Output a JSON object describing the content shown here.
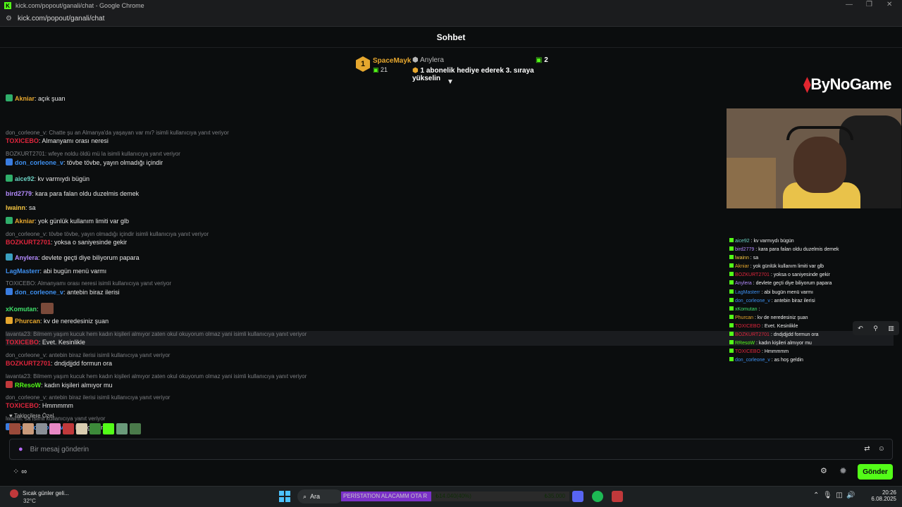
{
  "window": {
    "title": "kick.com/popout/ganali/chat - Google Chrome",
    "url": "kick.com/popout/ganali/chat",
    "controls": [
      "—",
      "❐",
      "✕"
    ]
  },
  "header": {
    "title": "Sohbet"
  },
  "pinned": {
    "rank": "1",
    "top_user": "SpaceMayk",
    "gift_count": "21",
    "second_user": "Anylera",
    "second_count": "2",
    "promo": "1 abonelik hediye ederek 3. sıraya yükselin"
  },
  "messages": [
    {
      "reply": "",
      "user": "Akniar",
      "color": "#e6a72e",
      "text": ": açık şuan",
      "badge": "#2fae6a"
    },
    {
      "reply": "don_corleone_v: Chatte şu an Almanya'da yaşayan var mı? isimli kullanıcıya yanıt veriyor",
      "user": "TOXICEBO",
      "color": "#e0263d",
      "text": ": Almanyamı orası neresi",
      "badge": ""
    },
    {
      "reply": "BOZKURT2701: wfeye noldu öldü mü la isimli kullanıcıya yanıt veriyor",
      "user": "don_corleone_v",
      "color": "#3e90f0",
      "text": ": tövbe tövbe, yayın olmadığı içindir",
      "badge": "#3a7de0"
    },
    {
      "reply": "",
      "user": "aice92",
      "color": "#6cd4c5",
      "text": ": kv varmıydı bügün",
      "badge": "#2fae6a"
    },
    {
      "reply": "",
      "user": "bird2779",
      "color": "#b58cff",
      "text": ": kara para falan oldu duzelmis demek",
      "badge": ""
    },
    {
      "reply": "",
      "user": "lwainn",
      "color": "#f5c542",
      "text": ": sa",
      "badge": ""
    },
    {
      "reply": "",
      "user": "Akniar",
      "color": "#e6a72e",
      "text": ": yok günlük kullanım limiti var glb",
      "badge": "#2fae6a"
    },
    {
      "reply": "don_corleone_v: tövbe tövbe, yayın olmadığı içindir isimli kullanıcıya yanıt veriyor",
      "user": "BOZKURT2701",
      "color": "#e0263d",
      "text": ": yoksa o saniyesinde gekir",
      "badge": ""
    },
    {
      "reply": "",
      "user": "Anylera",
      "color": "#b58cff",
      "text": ": devlete geçti diye biliyorum papara",
      "badge": "#3aa0c0"
    },
    {
      "reply": "",
      "user": "LagMasterr",
      "color": "#3e90f0",
      "text": ": abi bugün menü varmı",
      "badge": ""
    },
    {
      "reply": "TOXICEBO: Almanyamı orası neresi isimli kullanıcıya yanıt veriyor",
      "user": "don_corleone_v",
      "color": "#3e90f0",
      "text": ": antebin biraz ilerisi",
      "badge": "#3a7de0"
    },
    {
      "reply": "",
      "user": "xKomutan",
      "color": "#3fe06a",
      "text": ":",
      "badge": "",
      "emote": true
    },
    {
      "reply": "",
      "user": "Phurcan",
      "color": "#e6a72e",
      "text": ": kv de neredesiniz şuan",
      "badge": "#e6a72e"
    },
    {
      "reply": "lavanta23: Bilmem yaşım kucuk hem kadın kişileri almıyor zaten okul okuyorum olmaz yani isimli kullanıcıya yanıt veriyor",
      "user": "TOXICEBO",
      "color": "#e0263d",
      "text": ": Evet. Kesinlikle",
      "badge": "",
      "highlight": true
    },
    {
      "reply": "don_corleone_v: antebin biraz ilerisi isimli kullanıcıya yanıt veriyor",
      "user": "BOZKURT2701",
      "color": "#e0263d",
      "text": ": dndjdjjdd formun ora",
      "badge": ""
    },
    {
      "reply": "lavanta23: Bilmem yaşım kucuk hem kadın kişileri almıyor zaten okul okuyorum olmaz yani isimli kullanıcıya yanıt veriyor",
      "user": "RResoW",
      "color": "#53fc18",
      "text": ": kadın kişileri almıyor mu",
      "badge": "#c0393b"
    },
    {
      "reply": "don_corleone_v: antebin biraz ilerisi isimli kullanıcıya yanıt veriyor",
      "user": "TOXICEBO",
      "color": "#e0263d",
      "text": ": Hmmmmm",
      "badge": ""
    },
    {
      "reply": "lwainn: sa isimli kullanıcıya yanıt veriyor",
      "user": "don_corleone_v",
      "color": "#3e90f0",
      "text": ": as hoş geldin",
      "badge": "#3a7de0"
    }
  ],
  "overlay": {
    "logo": "ByNoGame",
    "mini_chat": [
      {
        "user": "aice92",
        "color": "#6cd4c5",
        "text": " : kv varmıydı bügün"
      },
      {
        "user": "bird2779",
        "color": "#b58cff",
        "text": " : kara para falan oldu duzelmis demek"
      },
      {
        "user": "lwainn",
        "color": "#f5c542",
        "text": " : sa"
      },
      {
        "user": "Akniar",
        "color": "#e6a72e",
        "text": " : yok günlük kullanım limiti var glb"
      },
      {
        "user": "BOZKURT2701",
        "color": "#e0263d",
        "text": " : yoksa o saniyesinde gekir"
      },
      {
        "user": "Anylera",
        "color": "#b58cff",
        "text": " : devlete geçti diye biliyorum papara"
      },
      {
        "user": "LagMasterr",
        "color": "#3e90f0",
        "text": " : abi bugün menü varmı"
      },
      {
        "user": "don_corleone_v",
        "color": "#3e90f0",
        "text": " : antebin biraz ilerisi"
      },
      {
        "user": "xKomutan",
        "color": "#3fe06a",
        "text": " :"
      },
      {
        "user": "Phurcan",
        "color": "#e6a72e",
        "text": " : kv de neredesiniz şuan"
      },
      {
        "user": "TOXICEBO",
        "color": "#e0263d",
        "text": " : Evet. Kesinlikle"
      },
      {
        "user": "BOZKURT2701",
        "color": "#e0263d",
        "text": " : dndjdjjdd formun ora"
      },
      {
        "user": "RResoW",
        "color": "#53fc18",
        "text": " : kadın kişileri almıyor mu"
      },
      {
        "user": "TOXICEBO",
        "color": "#e0263d",
        "text": " : Hmmmmm"
      },
      {
        "user": "don_corleone_v",
        "color": "#3e90f0",
        "text": " : as hoş geldin"
      }
    ]
  },
  "emote_section": {
    "label": "Takipçilere Özel"
  },
  "input": {
    "placeholder": "Bir mesaj gönderin"
  },
  "send_label": "Gönder",
  "taskbar": {
    "weather_text": "Sıcak günler geli...",
    "weather_temp": "32°C",
    "search_label": "Ara",
    "progress_label": "PERİSTATION ALACAMM OTA R",
    "progress_value": "₺14.040(40%)",
    "progress_goal": "₺35.000",
    "progress_fraction": 0.4,
    "time": "20:26",
    "date": "6.08.2025"
  },
  "colors": {
    "accent": "#53fc18",
    "background": "#0b0d0e"
  }
}
